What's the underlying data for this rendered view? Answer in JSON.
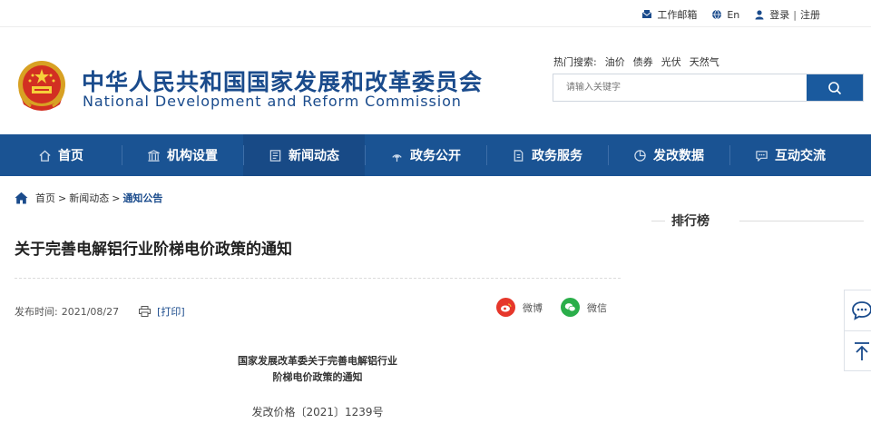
{
  "topbar": {
    "mail": "工作邮箱",
    "lang": "En",
    "login": "登录",
    "sep": "|",
    "register": "注册"
  },
  "header": {
    "title_cn": "中华人民共和国国家发展和改革委员会",
    "title_en": "National Development and Reform Commission",
    "hot_label": "热门搜索:",
    "hot_terms": [
      "油价",
      "债券",
      "光伏",
      "天然气"
    ],
    "search_placeholder": "请输入关键字"
  },
  "nav": {
    "items": [
      {
        "label": "首页",
        "icon": "home-icon"
      },
      {
        "label": "机构设置",
        "icon": "building-icon"
      },
      {
        "label": "新闻动态",
        "icon": "news-icon"
      },
      {
        "label": "政务公开",
        "icon": "broadcast-icon"
      },
      {
        "label": "政务服务",
        "icon": "document-icon"
      },
      {
        "label": "发改数据",
        "icon": "pie-chart-icon"
      },
      {
        "label": "互动交流",
        "icon": "chat-icon"
      }
    ],
    "active_index": 2
  },
  "breadcrumb": {
    "home": "首页",
    "sep1": ">",
    "section": "新闻动态",
    "sep2": ">",
    "current": "通知公告"
  },
  "article": {
    "title": "关于完善电解铝行业阶梯电价政策的通知",
    "date_label": "发布时间:",
    "date": "2021/08/27",
    "print": "[打印]",
    "share_weibo": "微博",
    "share_wechat": "微信",
    "doc_heading_line1": "国家发展改革委关于完善电解铝行业",
    "doc_heading_line2": "阶梯电价政策的通知",
    "doc_number": "发改价格〔2021〕1239号"
  },
  "sidebar": {
    "rank_title": "排行榜"
  },
  "colors": {
    "brand_blue": "#1a5393",
    "title_blue": "#1a4b8c",
    "weibo_red": "#e6372b",
    "wechat_green": "#2aae4a"
  }
}
